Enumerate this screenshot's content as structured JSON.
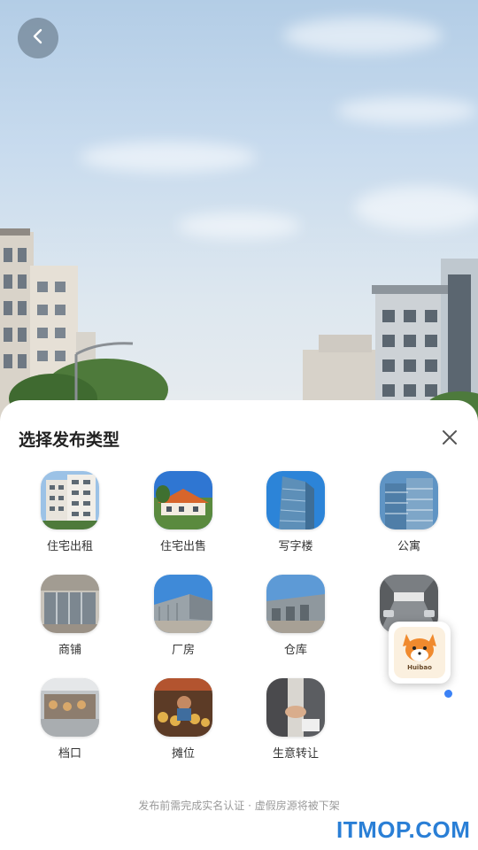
{
  "header": {
    "back_icon": "chevron-left-icon"
  },
  "sheet": {
    "title": "选择发布类型",
    "close_icon": "close-icon",
    "types": [
      {
        "label": "住宅出租",
        "image": "residential-rent-photo"
      },
      {
        "label": "住宅出售",
        "image": "residential-sale-photo"
      },
      {
        "label": "写字楼",
        "image": "office-building-photo"
      },
      {
        "label": "公寓",
        "image": "apartment-photo"
      },
      {
        "label": "商铺",
        "image": "shop-photo"
      },
      {
        "label": "厂房",
        "image": "factory-photo"
      },
      {
        "label": "仓库",
        "image": "warehouse-photo"
      },
      {
        "label": "",
        "image": "parking-photo"
      },
      {
        "label": "档口",
        "image": "stall-photo"
      },
      {
        "label": "摊位",
        "image": "booth-photo"
      },
      {
        "label": "生意转让",
        "image": "business-transfer-photo"
      }
    ],
    "notice": "发布前需完成实名认证 · 虚假房源将被下架"
  },
  "floating": {
    "brand": "Huibao",
    "icon": "fox-mascot-icon"
  },
  "watermark": "ITMOP.COM",
  "colors": {
    "accent": "#3b82f6",
    "watermark": "#2a7fd6"
  }
}
